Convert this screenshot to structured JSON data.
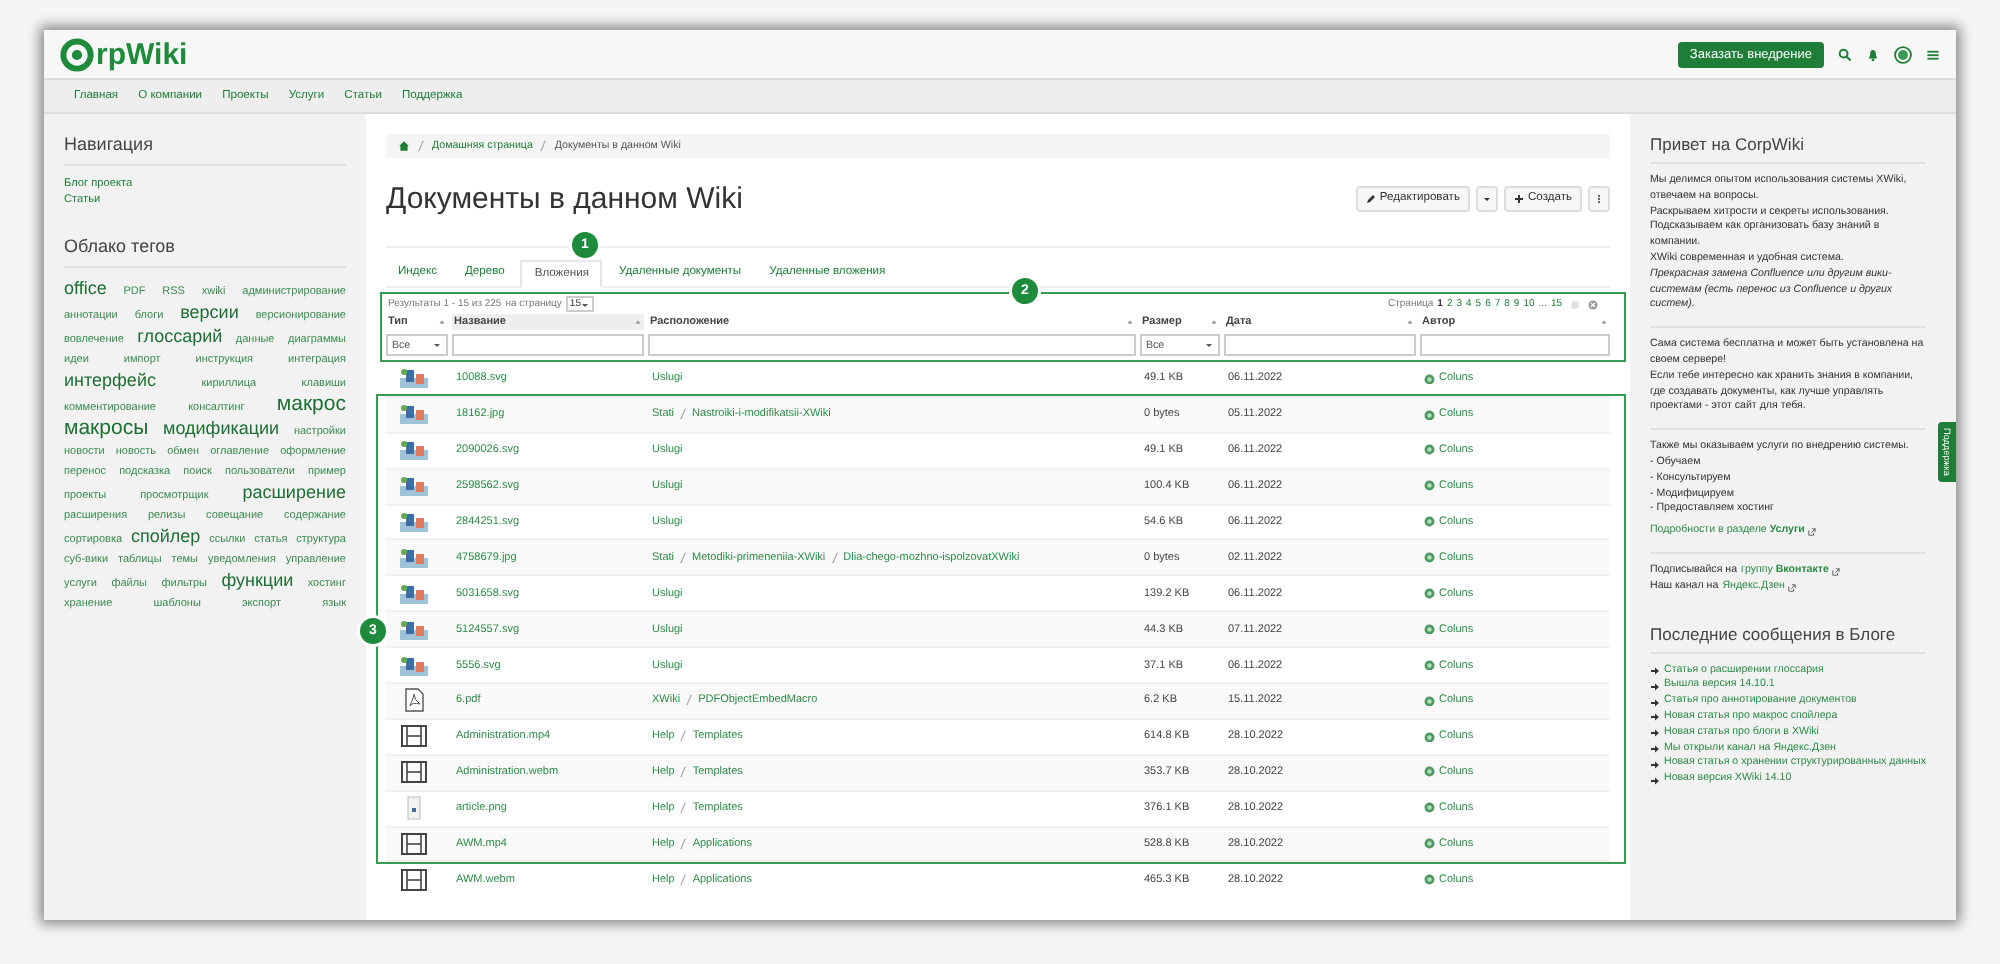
{
  "header": {
    "logo": "rpWiki",
    "order_button": "Заказать внедрение"
  },
  "nav": [
    "Главная",
    "О компании",
    "Проекты",
    "Услуги",
    "Статьи",
    "Поддержка"
  ],
  "left": {
    "nav_title": "Навигация",
    "nav_items": [
      "Блог проекта",
      "Статьи"
    ],
    "tags_title": "Облако тегов",
    "tags": [
      {
        "label": "office",
        "kind": "large"
      },
      {
        "label": "PDF",
        "kind": "small"
      },
      {
        "label": "RSS",
        "kind": "small"
      },
      {
        "label": "xwiki",
        "kind": "small"
      },
      {
        "label": "администрирование",
        "kind": "small"
      },
      {
        "label": "аннотации",
        "kind": "small"
      },
      {
        "label": "блоги",
        "kind": "small"
      },
      {
        "label": "версии",
        "kind": "large"
      },
      {
        "label": "версионирование",
        "kind": "small"
      },
      {
        "label": "вовлечение",
        "kind": "small"
      },
      {
        "label": "глоссарий",
        "kind": "large"
      },
      {
        "label": "данные",
        "kind": "small"
      },
      {
        "label": "диаграммы",
        "kind": "small"
      },
      {
        "label": "идеи",
        "kind": "small"
      },
      {
        "label": "импорт",
        "kind": "small"
      },
      {
        "label": "инструкция",
        "kind": "small"
      },
      {
        "label": "интеграция",
        "kind": "small"
      },
      {
        "label": "интерфейс",
        "kind": "large"
      },
      {
        "label": "кириллица",
        "kind": "small"
      },
      {
        "label": "клавиши",
        "kind": "small"
      },
      {
        "label": "комментирование",
        "kind": "small"
      },
      {
        "label": "консалтинг",
        "kind": "small"
      },
      {
        "label": "макрос",
        "kind": "huge"
      },
      {
        "label": "макросы",
        "kind": "huge"
      },
      {
        "label": "модификации",
        "kind": "large"
      },
      {
        "label": "настройки",
        "kind": "small"
      },
      {
        "label": "новости",
        "kind": "small"
      },
      {
        "label": "новость",
        "kind": "small"
      },
      {
        "label": "обмен",
        "kind": "small"
      },
      {
        "label": "оглавление",
        "kind": "small"
      },
      {
        "label": "оформление",
        "kind": "small"
      },
      {
        "label": "перенос",
        "kind": "small"
      },
      {
        "label": "подсказка",
        "kind": "small"
      },
      {
        "label": "поиск",
        "kind": "small"
      },
      {
        "label": "пользователи",
        "kind": "small"
      },
      {
        "label": "пример",
        "kind": "small"
      },
      {
        "label": "проекты",
        "kind": "small"
      },
      {
        "label": "просмотрщик",
        "kind": "small"
      },
      {
        "label": "расширение",
        "kind": "large"
      },
      {
        "label": "расширения",
        "kind": "small"
      },
      {
        "label": "релизы",
        "kind": "small"
      },
      {
        "label": "совещание",
        "kind": "small"
      },
      {
        "label": "содержание",
        "kind": "small"
      },
      {
        "label": "сортировка",
        "kind": "small"
      },
      {
        "label": "спойлер",
        "kind": "large"
      },
      {
        "label": "ссылки",
        "kind": "small"
      },
      {
        "label": "статья",
        "kind": "small"
      },
      {
        "label": "структура",
        "kind": "small"
      },
      {
        "label": "суб-вики",
        "kind": "small"
      },
      {
        "label": "таблицы",
        "kind": "small"
      },
      {
        "label": "темы",
        "kind": "small"
      },
      {
        "label": "уведомления",
        "kind": "small"
      },
      {
        "label": "управление",
        "kind": "small"
      },
      {
        "label": "услуги",
        "kind": "small"
      },
      {
        "label": "файлы",
        "kind": "small"
      },
      {
        "label": "фильтры",
        "kind": "small"
      },
      {
        "label": "функции",
        "kind": "large"
      },
      {
        "label": "хостинг",
        "kind": "small"
      },
      {
        "label": "хранение",
        "kind": "small"
      },
      {
        "label": "шаблоны",
        "kind": "small"
      },
      {
        "label": "экспорт",
        "kind": "small"
      },
      {
        "label": "язык",
        "kind": "small"
      }
    ]
  },
  "breadcrumb": [
    "Домашняя страница",
    "Документы в данном Wiki"
  ],
  "title": "Документы в данном Wiki",
  "actions": {
    "edit": "Редактировать",
    "create": "Создать"
  },
  "tabs": [
    {
      "label": "Индекс",
      "selected": false
    },
    {
      "label": "Дерево",
      "selected": false
    },
    {
      "label": "Вложения",
      "selected": true
    },
    {
      "label": "Удаленные документы",
      "selected": false
    },
    {
      "label": "Удаленные вложения",
      "selected": false
    }
  ],
  "pager": {
    "results": "Результаты 1 - 15 из 225",
    "per_page_label": "на страницу",
    "per_page": "15",
    "page_label": "Страница",
    "pages": [
      {
        "label": "1",
        "selected": true
      },
      {
        "label": "2",
        "selected": false
      },
      {
        "label": "3",
        "selected": false
      },
      {
        "label": "4",
        "selected": false
      },
      {
        "label": "5",
        "selected": false
      },
      {
        "label": "6",
        "selected": false
      },
      {
        "label": "7",
        "selected": false
      },
      {
        "label": "8",
        "selected": false
      },
      {
        "label": "9",
        "selected": false
      },
      {
        "label": "10",
        "selected": false
      },
      {
        "label": "...",
        "selected": false
      },
      {
        "label": "15",
        "selected": false
      }
    ]
  },
  "table": {
    "columns": [
      {
        "label": "Тип",
        "sorted": false,
        "kind": "select",
        "value": "Все"
      },
      {
        "label": "Название",
        "sorted": true,
        "kind": "input"
      },
      {
        "label": "Расположение",
        "sorted": false,
        "kind": "input"
      },
      {
        "label": "Размер",
        "sorted": false,
        "kind": "select",
        "value": "Все"
      },
      {
        "label": "Дата",
        "sorted": false,
        "kind": "input"
      },
      {
        "label": "Автор",
        "sorted": false,
        "kind": "input"
      }
    ],
    "rows": [
      {
        "kind": "image",
        "name": "10088.svg",
        "location": [
          "Uslugi"
        ],
        "size": "49.1 KB",
        "date": "06.11.2022",
        "author": "Coluns"
      },
      {
        "kind": "image",
        "name": "18162.jpg",
        "location": [
          "Stati",
          "Nastroiki-i-modifikatsii-XWiki"
        ],
        "size": "0 bytes",
        "date": "05.11.2022",
        "author": "Coluns"
      },
      {
        "kind": "image",
        "name": "2090026.svg",
        "location": [
          "Uslugi"
        ],
        "size": "49.1 KB",
        "date": "06.11.2022",
        "author": "Coluns"
      },
      {
        "kind": "image",
        "name": "2598562.svg",
        "location": [
          "Uslugi"
        ],
        "size": "100.4 KB",
        "date": "06.11.2022",
        "author": "Coluns"
      },
      {
        "kind": "image",
        "name": "2844251.svg",
        "location": [
          "Uslugi"
        ],
        "size": "54.6 KB",
        "date": "06.11.2022",
        "author": "Coluns"
      },
      {
        "kind": "image",
        "name": "4758679.jpg",
        "location": [
          "Stati",
          "Metodiki-primeneniia-XWiki",
          "Dlia-chego-mozhno-ispolzovatXWiki"
        ],
        "size": "0 bytes",
        "date": "02.11.2022",
        "author": "Coluns"
      },
      {
        "kind": "image",
        "name": "5031658.svg",
        "location": [
          "Uslugi"
        ],
        "size": "139.2 KB",
        "date": "06.11.2022",
        "author": "Coluns"
      },
      {
        "kind": "image",
        "name": "5124557.svg",
        "location": [
          "Uslugi"
        ],
        "size": "44.3 KB",
        "date": "07.11.2022",
        "author": "Coluns"
      },
      {
        "kind": "image",
        "name": "5556.svg",
        "location": [
          "Uslugi"
        ],
        "size": "37.1 KB",
        "date": "06.11.2022",
        "author": "Coluns"
      },
      {
        "kind": "pdf",
        "name": "6.pdf",
        "location": [
          "XWiki",
          "PDFObjectEmbedMacro"
        ],
        "size": "6.2 KB",
        "date": "15.11.2022",
        "author": "Coluns"
      },
      {
        "kind": "video",
        "name": "Administration.mp4",
        "location": [
          "Help",
          "Templates"
        ],
        "size": "614.8 KB",
        "date": "28.10.2022",
        "author": "Coluns"
      },
      {
        "kind": "video",
        "name": "Administration.webm",
        "location": [
          "Help",
          "Templates"
        ],
        "size": "353.7 KB",
        "date": "28.10.2022",
        "author": "Coluns"
      },
      {
        "kind": "document",
        "name": "article.png",
        "location": [
          "Help",
          "Templates"
        ],
        "size": "376.1 KB",
        "date": "28.10.2022",
        "author": "Coluns"
      },
      {
        "kind": "video",
        "name": "AWM.mp4",
        "location": [
          "Help",
          "Applications"
        ],
        "size": "528.8 KB",
        "date": "28.10.2022",
        "author": "Coluns"
      },
      {
        "kind": "video",
        "name": "AWM.webm",
        "location": [
          "Help",
          "Applications"
        ],
        "size": "465.3 KB",
        "date": "28.10.2022",
        "author": "Coluns"
      }
    ]
  },
  "annotations": [
    {
      "number": "1",
      "framed": false
    },
    {
      "number": "2",
      "framed": true
    },
    {
      "number": "3",
      "framed": true
    }
  ],
  "right": {
    "welcome_title": "Привет на CorpWiki",
    "intro": [
      "Мы делимся опытом использования системы XWiki, отвечаем на вопросы.",
      "Раскрываем хитрости и секреты использования.",
      "Подсказываем как организовать базу знаний в компании.",
      "XWiki современная и удобная система.",
      "*Прекрасная замена Confluence или другим вики-системам (есть перенос из Confluence и других систем).*"
    ],
    "free": [
      "Сама система бесплатна и может быть установлена на своем сервере!",
      "Если тебе интересно как хранить знания в компании, где создавать документы, как лучше управлять проектами - этот сайт для тебя."
    ],
    "services": [
      "Также мы оказываем услуги по внедрению системы.",
      "- Обучаем",
      "- Консультируем",
      "- Модифицируем",
      "- Предоставляем хостинг"
    ],
    "services_link": "Подробности в разделе **Услуги**",
    "social": [
      {
        "text": "Подписывайся на",
        "link": "группу **Вконтакте**"
      },
      {
        "text": "Наш канал на",
        "link": "Яндекс.Дзен"
      }
    ],
    "blog_title": "Последние сообщения в Блоге",
    "blog": [
      "Статья о расширении глоссария",
      "Вышла версия 14.10.1",
      "Статья про аннотирование документов",
      "Новая статья про макрос спойлера",
      "Новая статья про блоги в XWiki",
      "Мы открыли канал на Яндекс.Дзен",
      "Новая статья о хранении структурированных данных",
      "Новая версия XWiki 14.10"
    ]
  },
  "support_tab": "Поддержка"
}
